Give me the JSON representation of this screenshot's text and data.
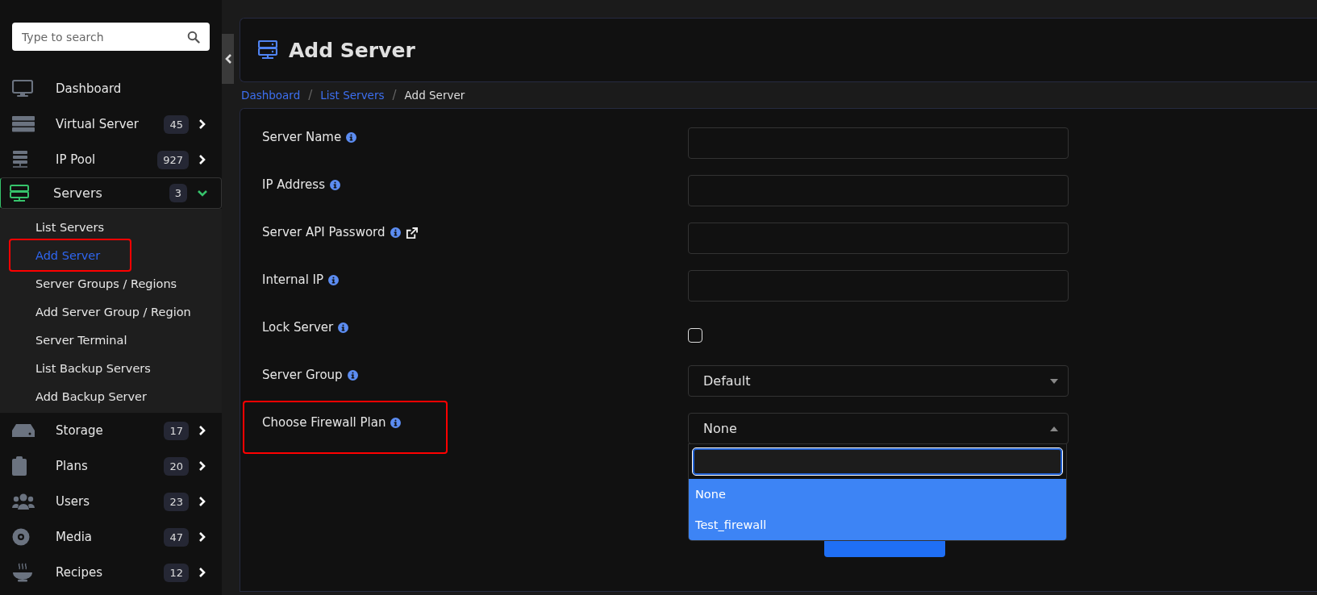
{
  "sidebar": {
    "search": {
      "placeholder": "Type to search"
    },
    "items": [
      {
        "label": "Dashboard",
        "selected": false
      },
      {
        "label": "Virtual Server",
        "count": "45",
        "selected": false,
        "expanded": false
      },
      {
        "label": "IP Pool",
        "count": "927",
        "selected": false,
        "expanded": false
      },
      {
        "label": "Servers",
        "count": "3",
        "selected": true,
        "expanded": true,
        "children": [
          {
            "label": "List Servers",
            "selected": false
          },
          {
            "label": "Add Server",
            "selected": true,
            "annotated": true
          },
          {
            "label": "Server Groups / Regions",
            "selected": false
          },
          {
            "label": "Add Server Group / Region",
            "selected": false
          },
          {
            "label": "Server Terminal",
            "selected": false
          },
          {
            "label": "List Backup Servers",
            "selected": false
          },
          {
            "label": "Add Backup Server",
            "selected": false
          }
        ]
      },
      {
        "label": "Storage",
        "count": "17",
        "selected": false,
        "expanded": false
      },
      {
        "label": "Plans",
        "count": "20",
        "selected": false,
        "expanded": false
      },
      {
        "label": "Users",
        "count": "23",
        "selected": false,
        "expanded": false
      },
      {
        "label": "Media",
        "count": "47",
        "selected": false,
        "expanded": false
      },
      {
        "label": "Recipes",
        "count": "12",
        "selected": false,
        "expanded": false
      }
    ]
  },
  "page": {
    "title": "Add Server"
  },
  "breadcrumb": [
    {
      "kind": "link",
      "label": "Dashboard"
    },
    {
      "kind": "separator",
      "label": "/"
    },
    {
      "kind": "link",
      "label": "List Servers"
    },
    {
      "kind": "separator",
      "label": "/"
    },
    {
      "kind": "current",
      "label": "Add Server"
    }
  ],
  "form": {
    "fields": [
      {
        "kind": "text",
        "label": "Server Name"
      },
      {
        "kind": "text",
        "label": "IP Address"
      },
      {
        "kind": "text",
        "label": "Server API Password",
        "external_link": true
      },
      {
        "kind": "text",
        "label": "Internal IP"
      },
      {
        "kind": "checkbox",
        "label": "Lock Server",
        "checked": false
      },
      {
        "kind": "select",
        "label": "Server Group",
        "value": "Default",
        "expanded": false
      },
      {
        "kind": "select",
        "label": "Choose Firewall Plan",
        "value": "None",
        "expanded": true,
        "annotated": true,
        "options": [
          {
            "label": "None",
            "highlighted": true
          },
          {
            "label": "Test_firewall",
            "highlighted": true
          }
        ]
      }
    ]
  }
}
